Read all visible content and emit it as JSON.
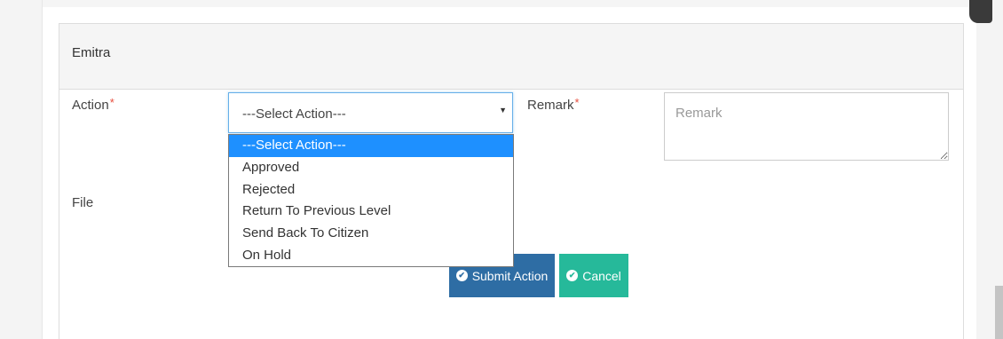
{
  "panel": {
    "title": "Emitra"
  },
  "form": {
    "action_label": "Action",
    "remark_label": "Remark",
    "file_label": "File",
    "required_marker": "*",
    "action_select": {
      "selected": "---Select Action---",
      "options": [
        "---Select Action---",
        "Approved",
        "Rejected",
        "Return To Previous Level",
        "Send Back To Citizen",
        "On Hold"
      ]
    },
    "remark_placeholder": "Remark"
  },
  "buttons": {
    "submit_label": "Submit Action",
    "cancel_label": "Cancel"
  },
  "icons": {
    "select_arrow": "caret-down-icon",
    "submit": "check-circle-icon",
    "cancel": "check-circle-icon"
  },
  "colors": {
    "submit_bg": "#2e6da4",
    "cancel_bg": "#26b99a",
    "option_highlight": "#1e90ff",
    "required": "#e74c3c"
  }
}
